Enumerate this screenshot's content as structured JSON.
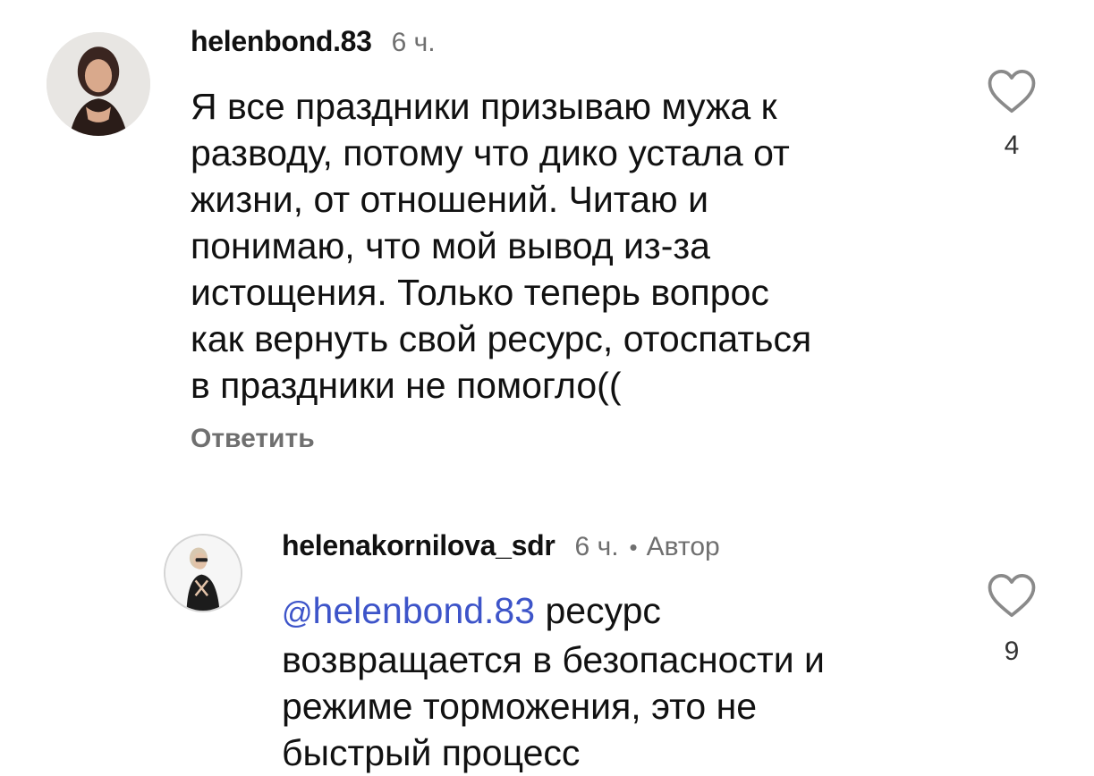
{
  "comments": [
    {
      "username": "helenbond.83",
      "time": "6 ч.",
      "lines": [
        "Я все праздники призываю мужа к",
        "разводу, потому что дико устала от",
        "жизни, от отношений. Читаю и",
        "понимаю, что мой вывод из-за",
        "истощения. Только теперь вопрос",
        "как вернуть свой ресурс, отоспаться",
        "в праздники не помогло(("
      ],
      "reply_label": "Ответить",
      "like_count": "4",
      "like_icon": "heart-outline-icon"
    },
    {
      "username": "helenakornilova_sdr",
      "time": "6 ч.",
      "separator": "•",
      "author_badge": "Автор",
      "mention_icon": "@",
      "mention": "helenbond.83",
      "first_line_rest": " ресурс",
      "lines": [
        "возвращается в безопасности и",
        "режиме торможения, это не",
        "быстрый процесс"
      ],
      "like_count": "9",
      "like_icon": "heart-outline-icon"
    }
  ]
}
